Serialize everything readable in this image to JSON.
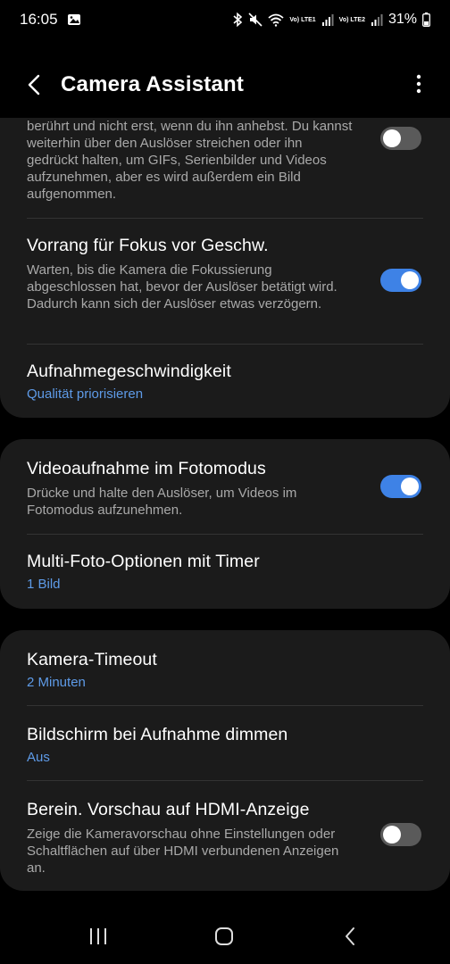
{
  "status": {
    "time": "16:05",
    "sim1": "Vo) LTE1",
    "sim2": "Vo) LTE2",
    "battery": "31%",
    "icons": [
      "gallery-notification-icon",
      "bluetooth-icon",
      "mute-icon",
      "wifi-icon",
      "signal-icon",
      "battery-icon"
    ]
  },
  "header": {
    "title": "Camera Assistant"
  },
  "settings": {
    "item0_desc": "berührt und nicht erst, wenn du ihn anhebst. Du kannst weiterhin über den Auslöser streichen oder ihn gedrückt halten, um GIFs, Serienbilder und Videos aufzunehmen, aber es wird außerdem ein Bild aufgenommen.",
    "item0_toggle": false,
    "item1_title": "Vorrang für Fokus vor Geschw.",
    "item1_desc": "Warten, bis die Kamera die Fokussierung abgeschlossen hat, bevor der Auslöser betätigt wird. Dadurch kann sich der Auslöser etwas verzögern.",
    "item1_toggle": true,
    "item2_title": "Aufnahmegeschwindigkeit",
    "item2_value": "Qualität priorisieren",
    "item3_title": "Videoaufnahme im Fotomodus",
    "item3_desc": "Drücke und halte den Auslöser, um Videos im Fotomodus aufzunehmen.",
    "item3_toggle": true,
    "item4_title": "Multi-Foto-Optionen mit Timer",
    "item4_value": "1 Bild",
    "item5_title": "Kamera-Timeout",
    "item5_value": "2 Minuten",
    "item6_title": "Bildschirm bei Aufnahme dimmen",
    "item6_value": "Aus",
    "item7_title": "Berein. Vorschau auf HDMI-Anzeige",
    "item7_desc": "Zeige die Kameravorschau ohne Einstellungen oder Schaltflächen auf über HDMI verbundenen Anzeigen an.",
    "item7_toggle": false
  },
  "colors": {
    "accent": "#3e82e6",
    "link": "#5e9be8",
    "card": "#1b1b1b"
  }
}
